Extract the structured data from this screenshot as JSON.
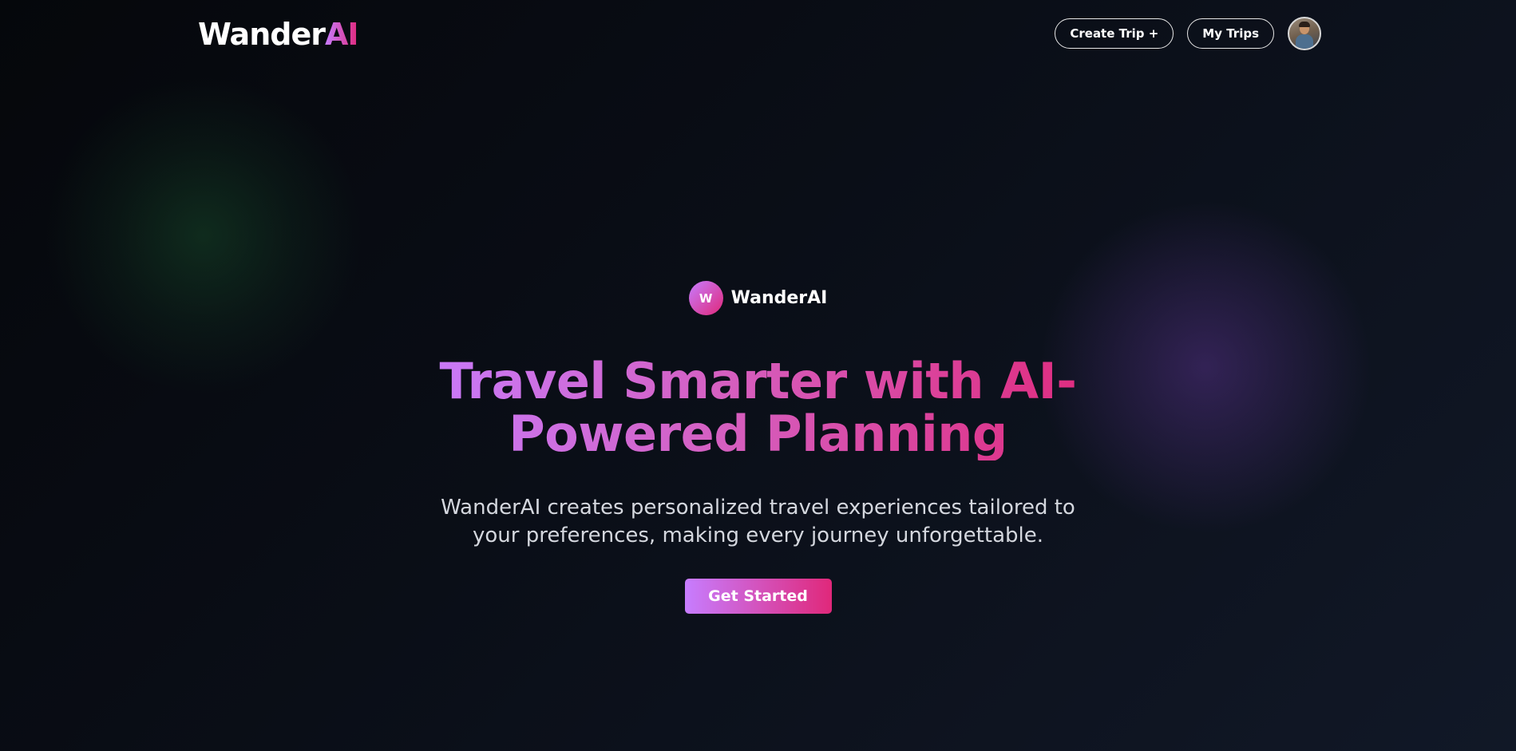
{
  "header": {
    "logo_text": "Wander",
    "logo_accent": "AI",
    "create_trip_label": "Create Trip +",
    "my_trips_label": "My Trips"
  },
  "hero": {
    "badge_letter": "W",
    "badge_text": "WanderAI",
    "headline": "Travel Smarter with AI-Powered Planning",
    "subtext": "WanderAI creates personalized travel experiences tailored to your preferences, making every journey unforgettable.",
    "cta_label": "Get Started"
  },
  "colors": {
    "background": "#0a0e17",
    "gradient_start": "#c77dff",
    "gradient_end": "#e0287a",
    "text_primary": "#ffffff",
    "text_secondary": "#d4d7de"
  },
  "icons": {
    "avatar": "user-avatar-photo"
  }
}
